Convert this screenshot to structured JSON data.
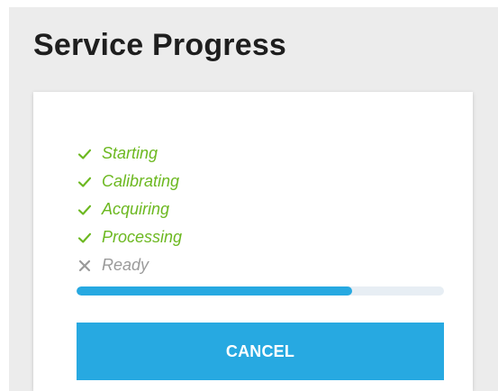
{
  "page": {
    "title": "Service Progress"
  },
  "steps": [
    {
      "label": "Starting",
      "status": "done",
      "icon": "check-icon"
    },
    {
      "label": "Calibrating",
      "status": "done",
      "icon": "check-icon"
    },
    {
      "label": "Acquiring",
      "status": "done",
      "icon": "check-icon"
    },
    {
      "label": "Processing",
      "status": "done",
      "icon": "check-icon"
    },
    {
      "label": "Ready",
      "status": "pending",
      "icon": "x-icon"
    }
  ],
  "progress": {
    "fraction": 0.75
  },
  "actions": {
    "cancel_label": "CANCEL"
  },
  "colors": {
    "done": "#6cb820",
    "pending": "#9a9a9a",
    "accent": "#27a9e1",
    "track": "#e7eef4"
  }
}
